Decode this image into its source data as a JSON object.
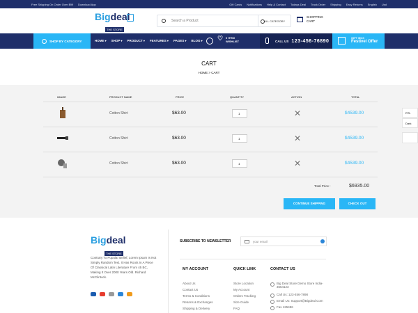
{
  "topbar": {
    "left": "Free Shipping On Order Over $99",
    "download": "Download App",
    "links": [
      "Gift Cards",
      "Notifications",
      "Help & Contact",
      "Todays Deal",
      "Track Order",
      "Shipping",
      "Easy Returns",
      "English",
      "Usd"
    ]
  },
  "logo": {
    "big": "Big",
    "deal": "deal",
    "store": "THE STORE"
  },
  "search": {
    "placeholder": "Search a Product",
    "category": "ALL CATEGORY"
  },
  "cart": {
    "label": "SHOPPING",
    "label2": "CART"
  },
  "nav": {
    "shop_by": "SHOP BY CATEGORY",
    "menu": [
      "HOME",
      "SHOP",
      "PRODUCT",
      "FEATURES",
      "PAGES",
      "BLOG"
    ],
    "wish_count": "0 ITEM",
    "wish_label": "WISHLIST",
    "call": "CALL US",
    "phone": "123-456-76890",
    "gift_small": "GIFT BOX",
    "gift_big": "Festivel Offer"
  },
  "page": {
    "title": "CART",
    "breadcrumbs": "HOME  >  CART"
  },
  "table": {
    "headers": [
      "IMAGE",
      "PRODUCT NAME",
      "PRICE",
      "QUANTITY",
      "ACTION",
      "TOTAL"
    ],
    "rows": [
      {
        "name": "Cotton Shirt",
        "price": "$63.00",
        "qty": "1",
        "total": "$4539.00"
      },
      {
        "name": "Cotton Shirt",
        "price": "$63.00",
        "qty": "1",
        "total": "$4539.00"
      },
      {
        "name": "Cotton Shirt",
        "price": "$63.00",
        "qty": "1",
        "total": "$4539.00"
      }
    ],
    "total_label": "Total Price :",
    "total_value": "$6935.00"
  },
  "buttons": {
    "continue": "CONTINUE SHIPPING",
    "checkout": "CHECK OUT"
  },
  "footer": {
    "desc": "Contrary To Popular Belief, Lorem Ipsum Is Not Simply Random Text. It Has Roots In A Piece Of Classical Latin Literature From 45 BC, Making It Over 2000 Years Old. Richard McClintock.",
    "newsletter": "SUBSCRIBE TO NEWSLETTER",
    "email_placeholder": "your email",
    "account": {
      "title": "MY ACCOUNT",
      "items": [
        "About Us",
        "Contact Us",
        "Terms & Conditions",
        "Returns & Exchanges",
        "Shipping & Delivery"
      ]
    },
    "quick": {
      "title": "QUICK LINK",
      "items": [
        "Store Location",
        "My Account",
        "Orders Tracking",
        "Size Guide",
        "FAQ"
      ]
    },
    "contact": {
      "title": "CONTACT US",
      "items": [
        "Big Deal Store Demo Store India-3654123",
        "Call Us: 123-456-7898",
        "Email Us: Support@Bigdeal.Com",
        "Fax 125486"
      ]
    }
  },
  "side": {
    "rtl": "RTL",
    "dark": "Dark"
  },
  "colors": {
    "navy": "#1f2f6a",
    "accent": "#29b6f6"
  }
}
